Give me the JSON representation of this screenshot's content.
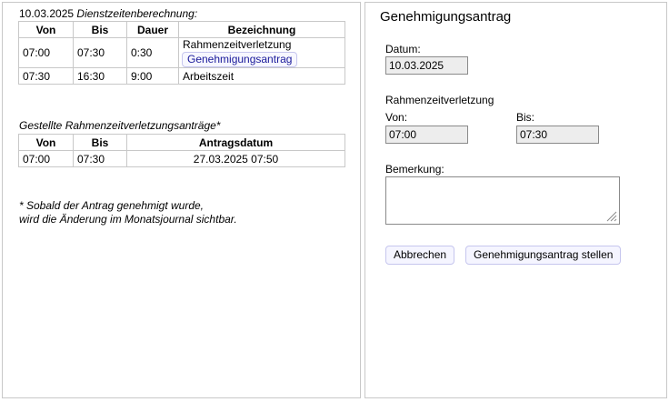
{
  "dienstzeiten": {
    "date": "10.03.2025",
    "title": "Dienstzeitenberechnung:",
    "columns": [
      "Von",
      "Bis",
      "Dauer",
      "Bezeichnung"
    ],
    "rows": [
      {
        "von": "07:00",
        "bis": "07:30",
        "dauer": "0:30",
        "bezeichnung": "Rahmenzeitverletzung",
        "link": "Genehmigungsantrag"
      },
      {
        "von": "07:30",
        "bis": "16:30",
        "dauer": "9:00",
        "bezeichnung": "Arbeitszeit"
      }
    ]
  },
  "antraege": {
    "title": "Gestellte Rahmenzeitverletzungsanträge*",
    "columns": [
      "Von",
      "Bis",
      "Antragsdatum"
    ],
    "rows": [
      {
        "von": "07:00",
        "bis": "07:30",
        "antragsdatum": "27.03.2025 07:50"
      }
    ]
  },
  "footnote": {
    "line1": "* Sobald der Antrag genehmigt wurde,",
    "line2": "wird die Änderung im Monatsjournal sichtbar."
  },
  "form": {
    "title": "Genehmigungsantrag",
    "datum_label": "Datum:",
    "datum_value": "10.03.2025",
    "section_label": "Rahmenzeitverletzung",
    "von_label": "Von:",
    "von_value": "07:00",
    "bis_label": "Bis:",
    "bis_value": "07:30",
    "bemerkung_label": "Bemerkung:",
    "bemerkung_value": "",
    "cancel_label": "Abbrechen",
    "submit_label": "Genehmigungsantrag stellen"
  },
  "colors": {
    "border": "#c8c8c8",
    "button_border": "#c6c6ee",
    "button_bg": "#f5f5ff",
    "field_bg": "#ededed",
    "link_text": "#1a1a9a"
  }
}
